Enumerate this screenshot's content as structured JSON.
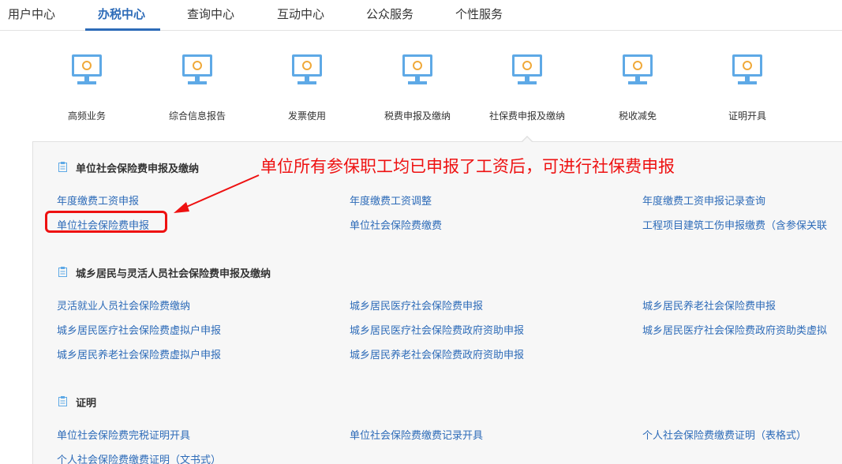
{
  "nav": {
    "items": [
      {
        "label": "用户中心"
      },
      {
        "label": "办税中心"
      },
      {
        "label": "查询中心"
      },
      {
        "label": "互动中心"
      },
      {
        "label": "公众服务"
      },
      {
        "label": "个性服务"
      }
    ],
    "active": "办税中心"
  },
  "services": [
    {
      "label": "高频业务",
      "icon": "monitor-icon"
    },
    {
      "label": "综合信息报告",
      "icon": "monitor-icon"
    },
    {
      "label": "发票使用",
      "icon": "monitor-icon"
    },
    {
      "label": "税费申报及缴纳",
      "icon": "monitor-icon"
    },
    {
      "label": "社保费申报及缴纳",
      "icon": "monitor-icon"
    },
    {
      "label": "税收减免",
      "icon": "monitor-icon"
    },
    {
      "label": "证明开具",
      "icon": "monitor-icon"
    }
  ],
  "annotation": "单位所有参保职工均已申报了工资后，可进行社保费申报",
  "sections": [
    {
      "title": "单位社会保险费申报及缴纳",
      "links": [
        "年度缴费工资申报",
        "年度缴费工资调整",
        "年度缴费工资申报记录查询",
        "单位社会保险费申报",
        "单位社会保险费缴费",
        "工程项目建筑工伤申报缴费（含参保关联"
      ]
    },
    {
      "title": "城乡居民与灵活人员社会保险费申报及缴纳",
      "links": [
        "灵活就业人员社会保险费缴纳",
        "城乡居民医疗社会保险费申报",
        "城乡居民养老社会保险费申报",
        "城乡居民医疗社会保险费虚拟户申报",
        "城乡居民医疗社会保险费政府资助申报",
        "城乡居民医疗社会保险费政府资助类虚拟",
        "城乡居民养老社会保险费虚拟户申报",
        "城乡居民养老社会保险费政府资助申报"
      ]
    },
    {
      "title": "证明",
      "links": [
        "单位社会保险费完税证明开具",
        "单位社会保险费缴费记录开具",
        "个人社会保险费缴费证明（表格式）",
        "个人社会保险费缴费证明（文书式）"
      ]
    }
  ],
  "colors": {
    "accent": "#2d6bb8",
    "link": "#2d6bb8",
    "annotation": "#e11111",
    "panel_bg": "#f7f7f7"
  }
}
